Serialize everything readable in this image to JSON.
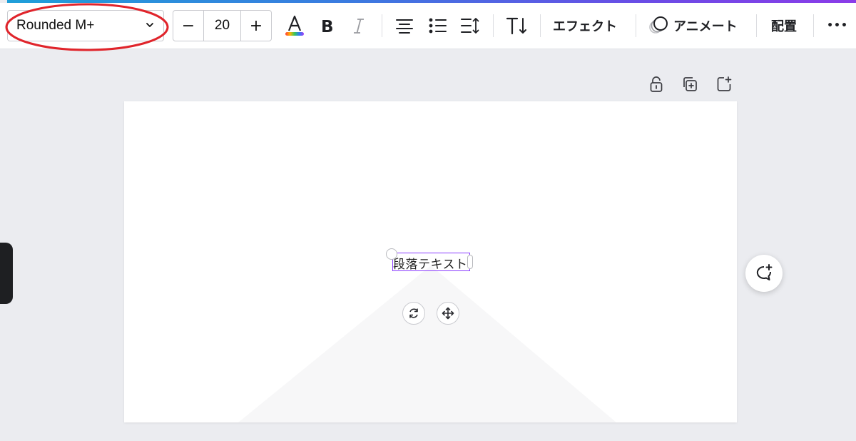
{
  "toolbar": {
    "font_family": "Rounded M+",
    "font_size": "20",
    "decrease_label": "−",
    "increase_label": "+",
    "effects_label": "エフェクト",
    "animate_label": "アニメート",
    "position_label": "配置",
    "more_label": "•••"
  },
  "canvas": {
    "text_element": "段落テキスト"
  },
  "colors": {
    "selection": "#8b3dff",
    "annotation": "#e0242b",
    "text_color_bar": "rainbow"
  },
  "icons": [
    "chevron-down-icon",
    "text-color-icon",
    "bold-icon",
    "italic-icon",
    "align-center-icon",
    "list-icon",
    "spacing-icon",
    "text-direction-icon",
    "animate-icon",
    "more-icon",
    "lock-icon",
    "duplicate-icon",
    "add-page-icon",
    "rotate-icon",
    "move-icon",
    "add-comment-icon"
  ]
}
